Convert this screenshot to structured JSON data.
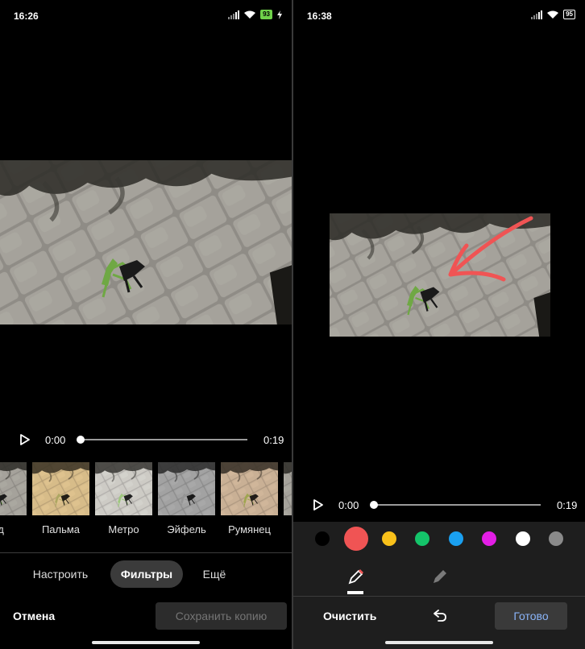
{
  "left": {
    "status": {
      "time": "16:26",
      "battery": "93"
    },
    "player": {
      "current_time": "0:00",
      "duration": "0:19",
      "progress": 0
    },
    "filters": [
      {
        "label": "ад"
      },
      {
        "label": "Пальма"
      },
      {
        "label": "Метро"
      },
      {
        "label": "Эйфель"
      },
      {
        "label": "Румянец"
      }
    ],
    "tabs": [
      {
        "label": "Настроить"
      },
      {
        "label": "Фильтры",
        "active": true
      },
      {
        "label": "Ещё"
      }
    ],
    "cancel_label": "Отмена",
    "save_copy_label": "Сохранить копию"
  },
  "right": {
    "status": {
      "time": "16:38",
      "battery": "95"
    },
    "player": {
      "current_time": "0:00",
      "duration": "0:19",
      "progress": 0
    },
    "palette": [
      {
        "name": "black",
        "color": "#000000"
      },
      {
        "name": "red",
        "color": "#f05454",
        "selected": true
      },
      {
        "name": "yellow",
        "color": "#f9c11a"
      },
      {
        "name": "green",
        "color": "#14c46a"
      },
      {
        "name": "blue",
        "color": "#1aa0f0"
      },
      {
        "name": "magenta",
        "color": "#e31ee6"
      },
      {
        "name": "white",
        "color": "#ffffff"
      },
      {
        "name": "gray",
        "color": "#8a8a8a"
      }
    ],
    "tools": [
      {
        "icon": "pen-icon",
        "active": true
      },
      {
        "icon": "marker-icon",
        "active": false
      }
    ],
    "clear_label": "Очистить",
    "undo_icon": "undo-icon",
    "done_label": "Готово"
  },
  "colors": {
    "accent_blue": "#8ab4f8",
    "annotation_red": "#f05454"
  }
}
